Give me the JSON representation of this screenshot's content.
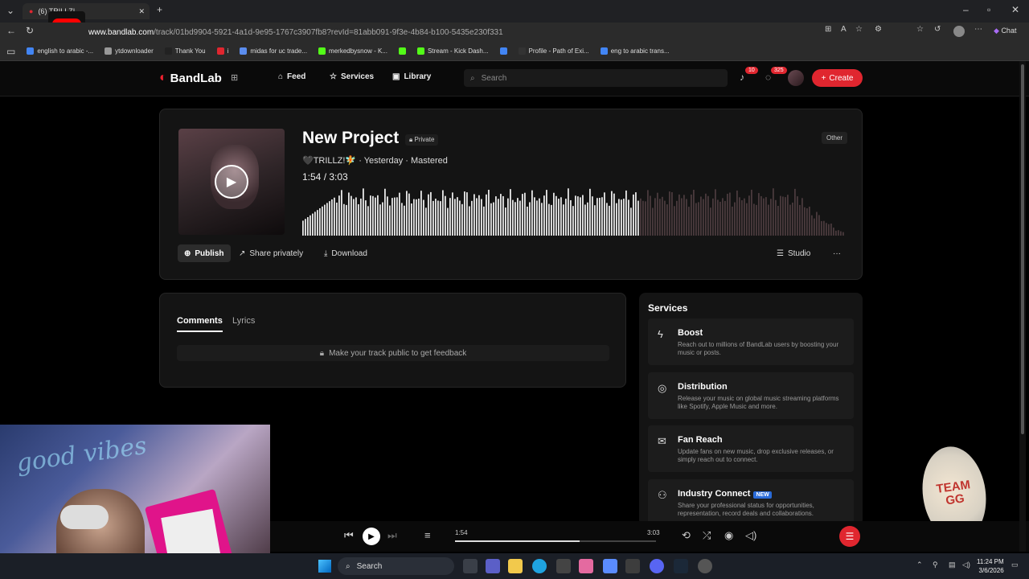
{
  "browser": {
    "tab_title": "(6) TRILLZ!",
    "url_host": "www.bandlab.com",
    "url_path": "/track/01bd9904-5921-4a1d-9e95-1767c3907fb8?revId=81abb091-9f3e-4b84-b100-5435e230f331",
    "chat_label": "Chat",
    "bookmarks": [
      {
        "label": "english to arabic -...",
        "color": "#4285f4"
      },
      {
        "label": "ytdownloader",
        "color": "#999999"
      },
      {
        "label": "Thank You",
        "color": "#222222"
      },
      {
        "label": "i",
        "color": "#e0262f"
      },
      {
        "label": "midas for uc trade...",
        "color": "#5b8def"
      },
      {
        "label": "merkedbysnow - K...",
        "color": "#53fc18"
      },
      {
        "label": "",
        "color": "#53fc18"
      },
      {
        "label": "Stream - Kick Dash...",
        "color": "#53fc18"
      },
      {
        "label": "",
        "color": "#4285f4"
      },
      {
        "label": "Profile - Path of Exi...",
        "color": "#333333"
      },
      {
        "label": "eng to arabic trans...",
        "color": "#4285f4"
      }
    ]
  },
  "header": {
    "logo": "BandLab",
    "nav": {
      "feed": "Feed",
      "services": "Services",
      "library": "Library"
    },
    "search_placeholder": "Search",
    "notifications_count": "10",
    "messages_count": "325",
    "create_label": "Create"
  },
  "track": {
    "title": "New Project",
    "privacy": "Private",
    "artist": "🖤TRILLZ!🧚",
    "meta_suffix": "· Yesterday · Mastered",
    "current_time": "1:54",
    "duration": "3:03",
    "progress_fraction": 0.62,
    "genre_tag": "Other",
    "actions": {
      "publish": "Publish",
      "share": "Share privately",
      "download": "Download",
      "studio": "Studio",
      "more": "···"
    }
  },
  "comments": {
    "tabs": [
      "Comments",
      "Lyrics"
    ],
    "message": "Make your track public to get feedback"
  },
  "services": {
    "heading": "Services",
    "items": [
      {
        "name": "Boost",
        "icon": "bolt-icon",
        "desc": "Reach out to millions of BandLab users by boosting your music or posts."
      },
      {
        "name": "Distribution",
        "icon": "globe-icon",
        "desc": "Release your music on global music streaming platforms like Spotify, Apple Music and more."
      },
      {
        "name": "Fan Reach",
        "icon": "mail-icon",
        "desc": "Update fans on new music, drop exclusive releases, or simply reach out to connect."
      },
      {
        "name": "Industry Connect",
        "icon": "people-icon",
        "badge": "NEW",
        "desc": "Share your professional status for opportunities, representation, record deals and collaborations."
      }
    ]
  },
  "player": {
    "current": "1:54",
    "total": "3:03",
    "progress_fraction": 0.62
  },
  "webcam": {
    "neon_text": "good vibes"
  },
  "stamp": {
    "text": "TEAM GG"
  },
  "taskbar": {
    "search_label": "Search",
    "time": "11:24 PM",
    "date": "3/6/2026"
  },
  "colors": {
    "accent": "#e0262f"
  }
}
